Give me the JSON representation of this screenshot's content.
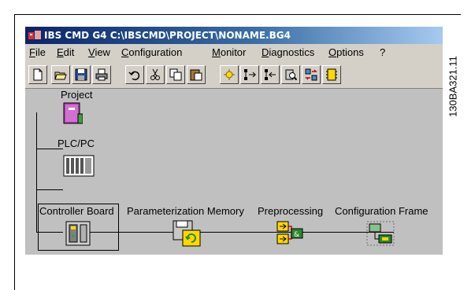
{
  "window": {
    "title": "IBS CMD G4 C:\\IBSCMD\\PROJECT\\NONAME.BG4"
  },
  "menu": {
    "items": [
      "File",
      "Edit",
      "View",
      "Configuration",
      "Monitor",
      "Diagnostics",
      "Options",
      "?"
    ]
  },
  "toolbar": {
    "buttons": [
      "new-icon",
      "open-icon",
      "save-icon",
      "print-icon",
      "undo-icon",
      "cut-icon",
      "copy-icon",
      "paste-icon",
      "parameterize-icon",
      "insert-after-icon",
      "insert-before-icon",
      "diagnose-icon",
      "exchange-icon",
      "device-icon"
    ]
  },
  "tree": {
    "project": "Project",
    "plc": "PLC/PC",
    "controller_board": "Controller Board",
    "parameterization_memory": "Parameterization Memory",
    "preprocessing": "Preprocessing",
    "configuration_frame": "Configuration Frame"
  },
  "reference_code": "130BA321.11"
}
